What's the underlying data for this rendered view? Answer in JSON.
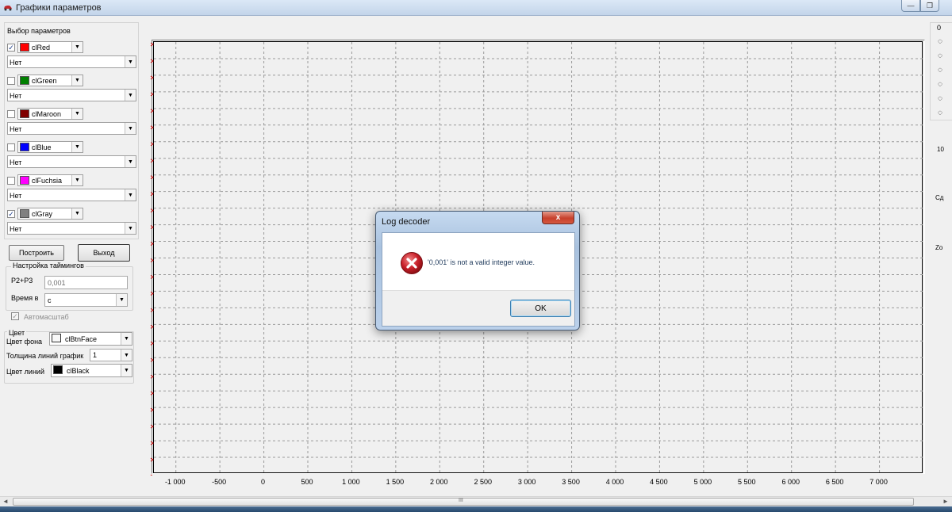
{
  "window": {
    "title": "Графики параметров",
    "minimize_glyph": "—",
    "restore_glyph": "❐"
  },
  "panel": {
    "title": "Выбор параметров",
    "params": [
      {
        "checked": true,
        "color_name": "clRed",
        "color": "#ff0000",
        "select": "Нет"
      },
      {
        "checked": false,
        "color_name": "clGreen",
        "color": "#008000",
        "select": "Нет"
      },
      {
        "checked": false,
        "color_name": "clMaroon",
        "color": "#800000",
        "select": "Нет"
      },
      {
        "checked": false,
        "color_name": "clBlue",
        "color": "#0000ff",
        "select": "Нет"
      },
      {
        "checked": false,
        "color_name": "clFuchsia",
        "color": "#ff00ff",
        "select": "Нет"
      },
      {
        "checked": true,
        "color_name": "clGray",
        "color": "#808080",
        "select": "Нет"
      }
    ]
  },
  "buttons": {
    "build": "Построить",
    "exit": "Выход"
  },
  "timing": {
    "title": "Настройка таймингов",
    "p2p3_label": "P2+P3",
    "p2p3_value": "0,001",
    "time_label": "Время в",
    "time_value": "с",
    "autoscale_label": "Автомасштаб",
    "autoscale_checked": true
  },
  "appearance": {
    "title": "Цвет",
    "bg_label": "Цвет фона",
    "bg_color_name": "clBtnFace",
    "bg_color": "#f0f0f0",
    "line_width_label": "Толщина линий график",
    "line_width_value": "1",
    "line_color_label": "Цвет линий",
    "line_color_name": "clBlack",
    "line_color": "#000000"
  },
  "chart_data": {
    "type": "line",
    "x_ticks": [
      "-1 000",
      "-500",
      "0",
      "500",
      "1 000",
      "1 500",
      "2 000",
      "2 500",
      "3 000",
      "3 500",
      "4 000",
      "4 500",
      "5 000",
      "5 500",
      "6 000",
      "6 500",
      "7 000"
    ],
    "x_tick_values": [
      -1000,
      -500,
      0,
      500,
      1000,
      1500,
      2000,
      2500,
      3000,
      3500,
      4000,
      4500,
      5000,
      5500,
      6000,
      6500,
      7000
    ],
    "xlim": [
      -1250,
      7500
    ],
    "grid": true,
    "series": []
  },
  "right_strip": {
    "label_top": "0",
    "label_10": "10",
    "label_sd": "Сд",
    "label_zo": "Zo"
  },
  "dialog": {
    "title": "Log decoder",
    "close_glyph": "x",
    "message": "'0,001' is not a valid integer value.",
    "ok_label": "OK"
  },
  "scrollbar": {
    "grip": "III",
    "left_arrow": "◄",
    "right_arrow": "►"
  }
}
